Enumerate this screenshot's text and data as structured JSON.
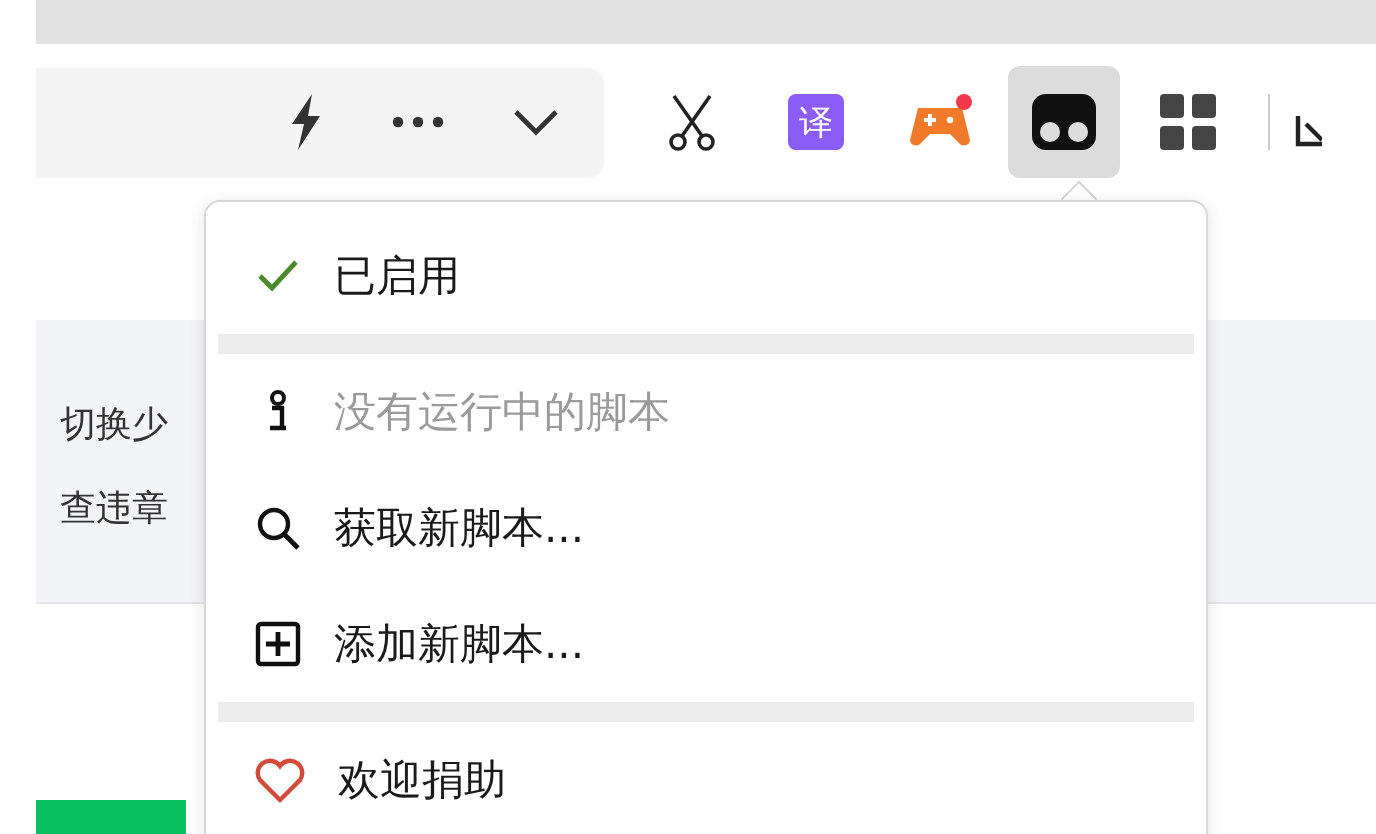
{
  "toolbar": {
    "translate_label": "译",
    "extension_active": true
  },
  "page": {
    "links": [
      {
        "label": "切换少"
      },
      {
        "label": "查违章"
      }
    ]
  },
  "menu": {
    "items": [
      {
        "kind": "check",
        "label": "已启用",
        "checked": true,
        "disabled": false
      },
      {
        "kind": "separator"
      },
      {
        "kind": "info",
        "label": "没有运行中的脚本",
        "disabled": true
      },
      {
        "kind": "search",
        "label": "获取新脚本...",
        "disabled": false
      },
      {
        "kind": "add",
        "label": "添加新脚本...",
        "disabled": false
      },
      {
        "kind": "separator"
      },
      {
        "kind": "heart",
        "label": "欢迎捐助",
        "disabled": false
      }
    ]
  }
}
